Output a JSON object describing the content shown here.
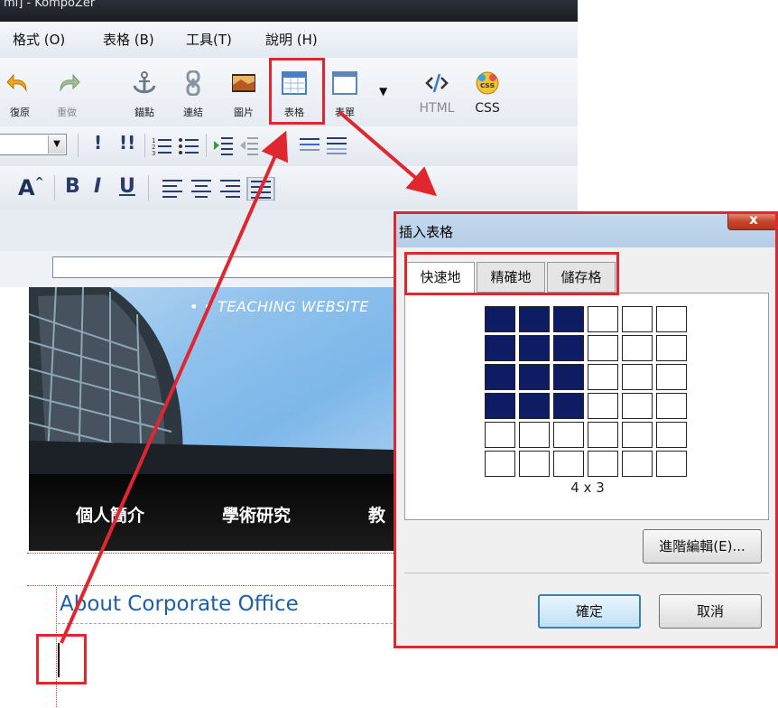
{
  "window": {
    "title": "ml] - KompoZer"
  },
  "menubar": {
    "items": [
      {
        "label": "格式 (O)"
      },
      {
        "label": "表格 (B)"
      },
      {
        "label": "工具(T)"
      },
      {
        "label": "說明 (H)"
      }
    ]
  },
  "toolbar": {
    "undo_label": "復原",
    "redo_label": "重做",
    "anchor_label": "錨點",
    "link_label": "連結",
    "image_label": "圖片",
    "table_label": "表格",
    "form_label": "表單",
    "html_label": "HTML",
    "css_label": "CSS"
  },
  "format_bar": {
    "bold": "B",
    "italic": "I",
    "underline": "U",
    "font_size": "A"
  },
  "page": {
    "banner_title": "• • TEACHING WEBSITE",
    "nav_items": [
      "個人簡介",
      "學術研究",
      "教"
    ],
    "heading": "About Corporate Office"
  },
  "dialog": {
    "title": "插入表格",
    "close": "x",
    "tabs": [
      "快速地",
      "精確地",
      "儲存格"
    ],
    "active_tab": 0,
    "grid": {
      "rows": 6,
      "cols": 6,
      "selected_rows": 4,
      "selected_cols": 3
    },
    "grid_size_label": "4 x 3",
    "advanced_button": "進階編輯(E)...",
    "ok_button": "確定",
    "cancel_button": "取消"
  },
  "colors": {
    "annotation_red": "#e0262e",
    "selected_cell": "#0e1d63",
    "heading_blue": "#1d5fa5"
  },
  "icons": [
    "undo-icon",
    "redo-icon",
    "anchor-icon",
    "link-icon",
    "image-icon",
    "table-icon",
    "form-icon",
    "html-icon",
    "css-icon"
  ]
}
